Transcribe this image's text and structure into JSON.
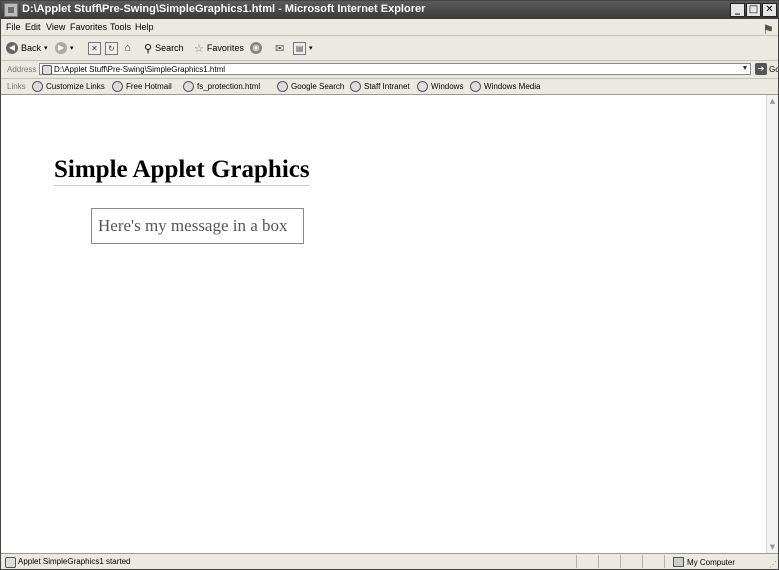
{
  "window": {
    "title": "D:\\Applet Stuff\\Pre-Swing\\SimpleGraphics1.html - Microsoft Internet Explorer",
    "minimize": "_",
    "maximize": "□",
    "close": "✕"
  },
  "menu": {
    "file": "File",
    "edit": "Edit",
    "view": "View",
    "favorites": "Favorites",
    "tools": "Tools",
    "help": "Help"
  },
  "toolbar": {
    "back": "Back",
    "search": "Search",
    "favorites": "Favorites"
  },
  "address": {
    "label": "Address",
    "value": "D:\\Applet Stuff\\Pre-Swing\\SimpleGraphics1.html",
    "go": "Go"
  },
  "links": {
    "label": "Links",
    "items": [
      "Customize Links",
      "Free Hotmail",
      "fs_protection.html",
      "Google Search",
      "Staff Intranet",
      "Windows",
      "Windows Media"
    ]
  },
  "page": {
    "heading": "Simple Applet Graphics",
    "applet_message": "Here's my message in a box"
  },
  "status": {
    "text": "Applet SimpleGraphics1 started",
    "zone": "My Computer"
  }
}
